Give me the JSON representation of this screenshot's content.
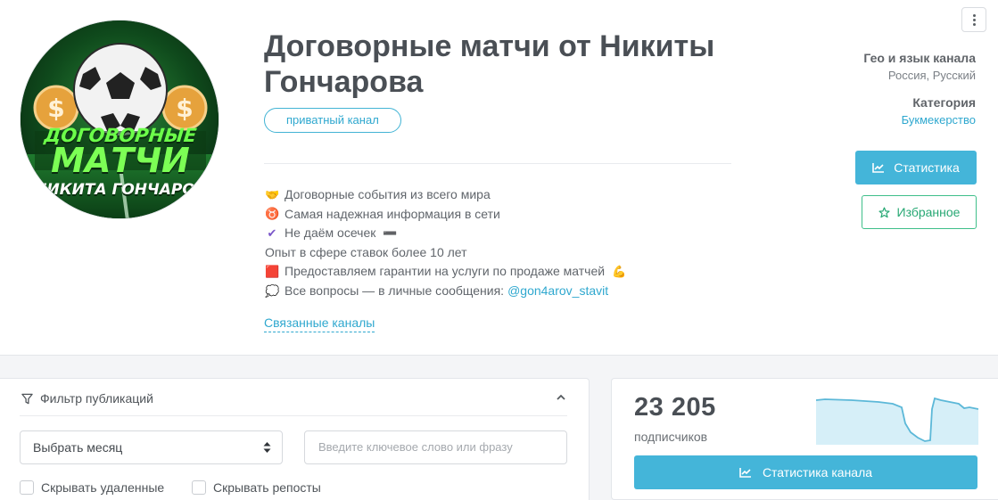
{
  "header": {
    "title": "Договорные матчи от Никиты Гончарова",
    "private_label": "приватный канал",
    "avatar": {
      "top_text": "ДОГОВОРНЫЕ",
      "mid_text": "МАТЧИ",
      "bottom_text": "НИКИТА ГОНЧАРОВ"
    }
  },
  "description": {
    "lines": [
      {
        "emoji": "🤝",
        "text": "Договорные события из всего мира"
      },
      {
        "emoji": "♉",
        "text": "Самая надежная информация в сети"
      },
      {
        "emoji": "✔",
        "text": "Не даём осечек",
        "emoji_after": "➖"
      },
      {
        "text": "Опыт в сфере ставок более 10 лет"
      },
      {
        "emoji": "🟥",
        "text": "Предоставляем гарантии на услуги по продаже матчей",
        "emoji_after": "💪"
      },
      {
        "emoji": "💭",
        "text": "Все вопросы — в личные сообщения:",
        "link": "@gon4arov_stavit"
      }
    ],
    "related_link": "Связанные каналы"
  },
  "sidebar": {
    "geo_label": "Гео и язык канала",
    "geo_value": "Россия, Русский",
    "category_label": "Категория",
    "category_value": "Букмекерство",
    "stats_button": "Статистика",
    "favorite_button": "Избранное"
  },
  "filter": {
    "title": "Фильтр публикаций",
    "month_select": "Выбрать месяц",
    "search_placeholder": "Введите ключевое слово или фразу",
    "hide_deleted": "Скрывать удаленные",
    "hide_reposts": "Скрывать репосты"
  },
  "stats": {
    "subscribers_count": "23 205",
    "subscribers_label": "подписчиков",
    "channel_stats_button": "Статистика канала"
  },
  "colors": {
    "accent": "#44b5d9",
    "link": "#2fa8cf",
    "favorite": "#3fbf8a",
    "sparkline_line": "#5cb8d8",
    "sparkline_fill": "#d6eff8"
  }
}
